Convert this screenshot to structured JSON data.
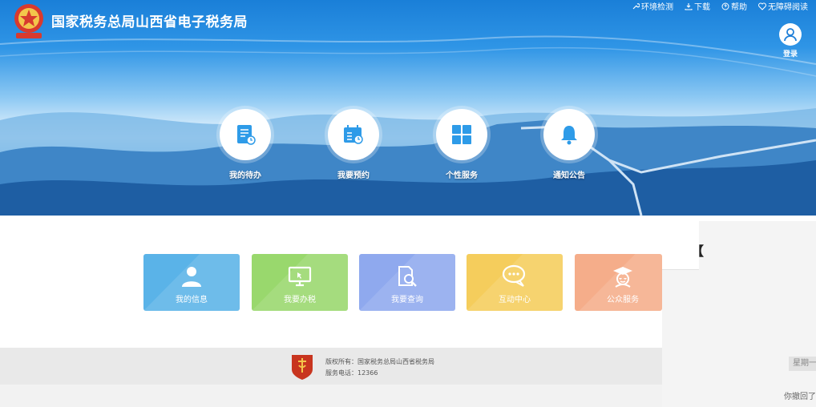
{
  "header": {
    "title": "国家税务总局山西省电子税务局",
    "toplinks": [
      {
        "label": "环境检测",
        "icon": "wrench-icon"
      },
      {
        "label": "下载",
        "icon": "download-icon"
      },
      {
        "label": "帮助",
        "icon": "help-icon"
      },
      {
        "label": "无障碍阅读",
        "icon": "heart-icon"
      }
    ],
    "login_label": "登录"
  },
  "quick_actions": [
    {
      "label": "我的待办",
      "icon": "todo-list-icon"
    },
    {
      "label": "我要预约",
      "icon": "calendar-clock-icon"
    },
    {
      "label": "个性服务",
      "icon": "grid-icon"
    },
    {
      "label": "通知公告",
      "icon": "bell-icon"
    }
  ],
  "tiles": [
    {
      "label": "我的信息",
      "icon": "user-icon",
      "color": "#5ab3e8"
    },
    {
      "label": "我要办税",
      "icon": "monitor-icon",
      "color": "#99d86d"
    },
    {
      "label": "我要查询",
      "icon": "document-search-icon",
      "color": "#8fa9ee"
    },
    {
      "label": "互动中心",
      "icon": "chat-icon",
      "color": "#f5cd5c"
    },
    {
      "label": "公众服务",
      "icon": "graduate-icon",
      "color": "#f5ad8a"
    }
  ],
  "footer": {
    "copyright": "版权所有：国家税务总局山西省税务局",
    "phone": "服务电话：12366"
  },
  "side_panel": {
    "bracket": "【",
    "week": "星期一",
    "revoke": "你撤回了"
  }
}
